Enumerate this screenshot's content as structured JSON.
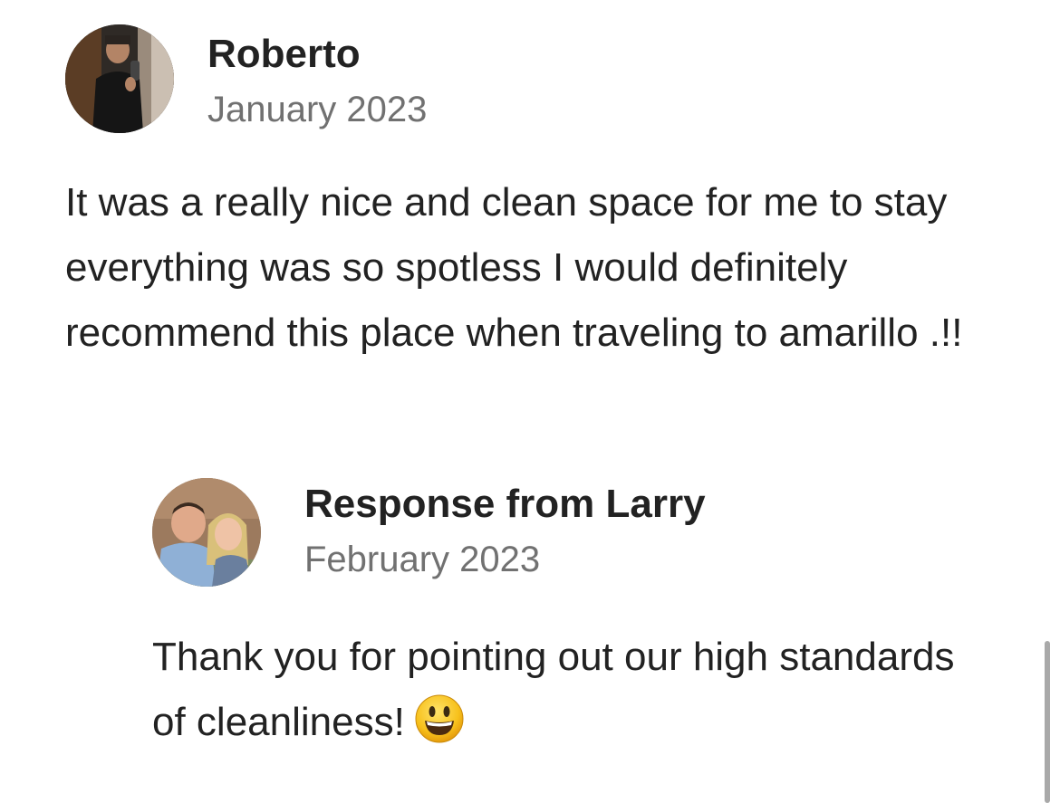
{
  "review": {
    "reviewer_name": "Roberto",
    "date": "January 2023",
    "text": "It was a really nice and clean space for me to stay everything was so spotless I would definitely recommend this place when traveling to amarillo .!!",
    "avatar_icon": "reviewer-photo"
  },
  "response": {
    "title": "Response from Larry",
    "date": "February 2023",
    "text": "Thank you for pointing out our high standards of cleanliness!",
    "emoji_icon": "smiley-emoji-icon",
    "avatar_icon": "host-photo"
  },
  "colors": {
    "text_primary": "#222222",
    "text_secondary": "#717171",
    "scrollbar": "#a9a9a9",
    "background": "#ffffff"
  }
}
